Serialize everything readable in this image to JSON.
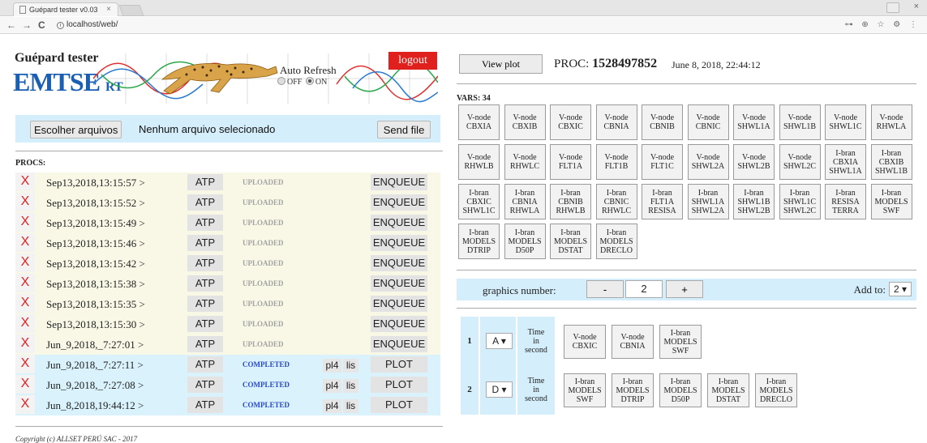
{
  "browser": {
    "tab_title": "Guépard tester v0.03",
    "tab_close": "×",
    "window_close": "×",
    "back": "←",
    "forward": "→",
    "reload": "C",
    "info": "i",
    "url": "localhost/web/",
    "addr_icons": "⊶ ⊕ ☆ ⚙ ⋮"
  },
  "brand": {
    "title": "Guépard tester",
    "logo_main": "EMTSE",
    "logo_sub": "RT"
  },
  "header": {
    "logout": "logout",
    "auto_refresh": "Auto Refresh",
    "off": "OFF",
    "on": "ON"
  },
  "upload": {
    "choose": "Escolher arquivos",
    "no_file": "Nenhum arquivo selecionado",
    "send": "Send file"
  },
  "procs_label": "PROCS:",
  "procs": [
    {
      "del": "X",
      "date": "Sep13,2018,13:15:57 >",
      "type": "ATP",
      "status": "UPLOADED",
      "f1": "",
      "f2": "",
      "action": "ENQUEUE",
      "state": "up"
    },
    {
      "del": "X",
      "date": "Sep13,2018,13:15:52 >",
      "type": "ATP",
      "status": "UPLOADED",
      "f1": "",
      "f2": "",
      "action": "ENQUEUE",
      "state": "up"
    },
    {
      "del": "X",
      "date": "Sep13,2018,13:15:49 >",
      "type": "ATP",
      "status": "UPLOADED",
      "f1": "",
      "f2": "",
      "action": "ENQUEUE",
      "state": "up"
    },
    {
      "del": "X",
      "date": "Sep13,2018,13:15:46 >",
      "type": "ATP",
      "status": "UPLOADED",
      "f1": "",
      "f2": "",
      "action": "ENQUEUE",
      "state": "up"
    },
    {
      "del": "X",
      "date": "Sep13,2018,13:15:42 >",
      "type": "ATP",
      "status": "UPLOADED",
      "f1": "",
      "f2": "",
      "action": "ENQUEUE",
      "state": "up"
    },
    {
      "del": "X",
      "date": "Sep13,2018,13:15:38 >",
      "type": "ATP",
      "status": "UPLOADED",
      "f1": "",
      "f2": "",
      "action": "ENQUEUE",
      "state": "up"
    },
    {
      "del": "X",
      "date": "Sep13,2018,13:15:35 >",
      "type": "ATP",
      "status": "UPLOADED",
      "f1": "",
      "f2": "",
      "action": "ENQUEUE",
      "state": "up"
    },
    {
      "del": "X",
      "date": "Sep13,2018,13:15:30 >",
      "type": "ATP",
      "status": "UPLOADED",
      "f1": "",
      "f2": "",
      "action": "ENQUEUE",
      "state": "up"
    },
    {
      "del": "X",
      "date": "Jun_9,2018,_7:27:01 >",
      "type": "ATP",
      "status": "UPLOADED",
      "f1": "",
      "f2": "",
      "action": "ENQUEUE",
      "state": "up"
    },
    {
      "del": "X",
      "date": "Jun_9,2018,_7:27:11 >",
      "type": "ATP",
      "status": "COMPLETED",
      "f1": "pl4",
      "f2": "lis",
      "action": "PLOT",
      "state": "done"
    },
    {
      "del": "X",
      "date": "Jun_9,2018,_7:27:08 >",
      "type": "ATP",
      "status": "COMPLETED",
      "f1": "pl4",
      "f2": "lis",
      "action": "PLOT",
      "state": "done"
    },
    {
      "del": "X",
      "date": "Jun_8,2018,19:44:12 >",
      "type": "ATP",
      "status": "COMPLETED",
      "f1": "pl4",
      "f2": "lis",
      "action": "PLOT",
      "state": "done"
    }
  ],
  "copyright": "Copyright (c) ALLSET PERÚ SAC - 2017",
  "plot": {
    "view_plot": "View plot",
    "proc_label": "PROC:",
    "proc_id": "1528497852",
    "proc_date": "June 8, 2018, 22:44:12"
  },
  "vars_label": "VARS:",
  "vars_count": "34",
  "vars": [
    [
      "V-node",
      "CBXIA"
    ],
    [
      "V-node",
      "CBXIB"
    ],
    [
      "V-node",
      "CBXIC"
    ],
    [
      "V-node",
      "CBNIA"
    ],
    [
      "V-node",
      "CBNIB"
    ],
    [
      "V-node",
      "CBNIC"
    ],
    [
      "V-node",
      "SHWL1A"
    ],
    [
      "V-node",
      "SHWL1B"
    ],
    [
      "V-node",
      "SHWL1C"
    ],
    [
      "V-node",
      "RHWLA"
    ],
    [
      "V-node",
      "RHWLB"
    ],
    [
      "V-node",
      "RHWLC"
    ],
    [
      "V-node",
      "FLT1A"
    ],
    [
      "V-node",
      "FLT1B"
    ],
    [
      "V-node",
      "FLT1C"
    ],
    [
      "V-node",
      "SHWL2A"
    ],
    [
      "V-node",
      "SHWL2B"
    ],
    [
      "V-node",
      "SHWL2C"
    ],
    [
      "I-bran",
      "CBXIA",
      "SHWL1A"
    ],
    [
      "I-bran",
      "CBXIB",
      "SHWL1B"
    ],
    [
      "I-bran",
      "CBXIC",
      "SHWL1C"
    ],
    [
      "I-bran",
      "CBNIA",
      "RHWLA"
    ],
    [
      "I-bran",
      "CBNIB",
      "RHWLB"
    ],
    [
      "I-bran",
      "CBNIC",
      "RHWLC"
    ],
    [
      "I-bran",
      "FLT1A",
      "RESISA"
    ],
    [
      "I-bran",
      "SHWL1A",
      "SHWL2A"
    ],
    [
      "I-bran",
      "SHWL1B",
      "SHWL2B"
    ],
    [
      "I-bran",
      "SHWL1C",
      "SHWL2C"
    ],
    [
      "I-bran",
      "RESISA",
      "TERRA"
    ],
    [
      "I-bran",
      "MODELS",
      "SWF"
    ],
    [
      "I-bran",
      "MODELS",
      "DTRIP"
    ],
    [
      "I-bran",
      "MODELS",
      "D50P"
    ],
    [
      "I-bran",
      "MODELS",
      "DSTAT"
    ],
    [
      "I-bran",
      "MODELS",
      "DRECLO"
    ]
  ],
  "graphics": {
    "label": "graphics number:",
    "minus": "-",
    "value": "2",
    "plus": "+",
    "add_to": "Add to:",
    "add_to_value": "2 ▾"
  },
  "graphs": [
    {
      "num": "1",
      "axis": "A ▾",
      "time": [
        "Time",
        "in",
        "second"
      ],
      "vars": [
        [
          "V-node",
          "CBXIC"
        ],
        [
          "V-node",
          "CBNIA"
        ],
        [
          "I-bran",
          "MODELS",
          "SWF"
        ]
      ]
    },
    {
      "num": "2",
      "axis": "D ▾",
      "time": [
        "Time",
        "in",
        "second"
      ],
      "vars": [
        [
          "I-bran",
          "MODELS",
          "SWF"
        ],
        [
          "I-bran",
          "MODELS",
          "DTRIP"
        ],
        [
          "I-bran",
          "MODELS",
          "D50P"
        ],
        [
          "I-bran",
          "MODELS",
          "DSTAT"
        ],
        [
          "I-bran",
          "MODELS",
          "DRECLO"
        ]
      ]
    }
  ]
}
